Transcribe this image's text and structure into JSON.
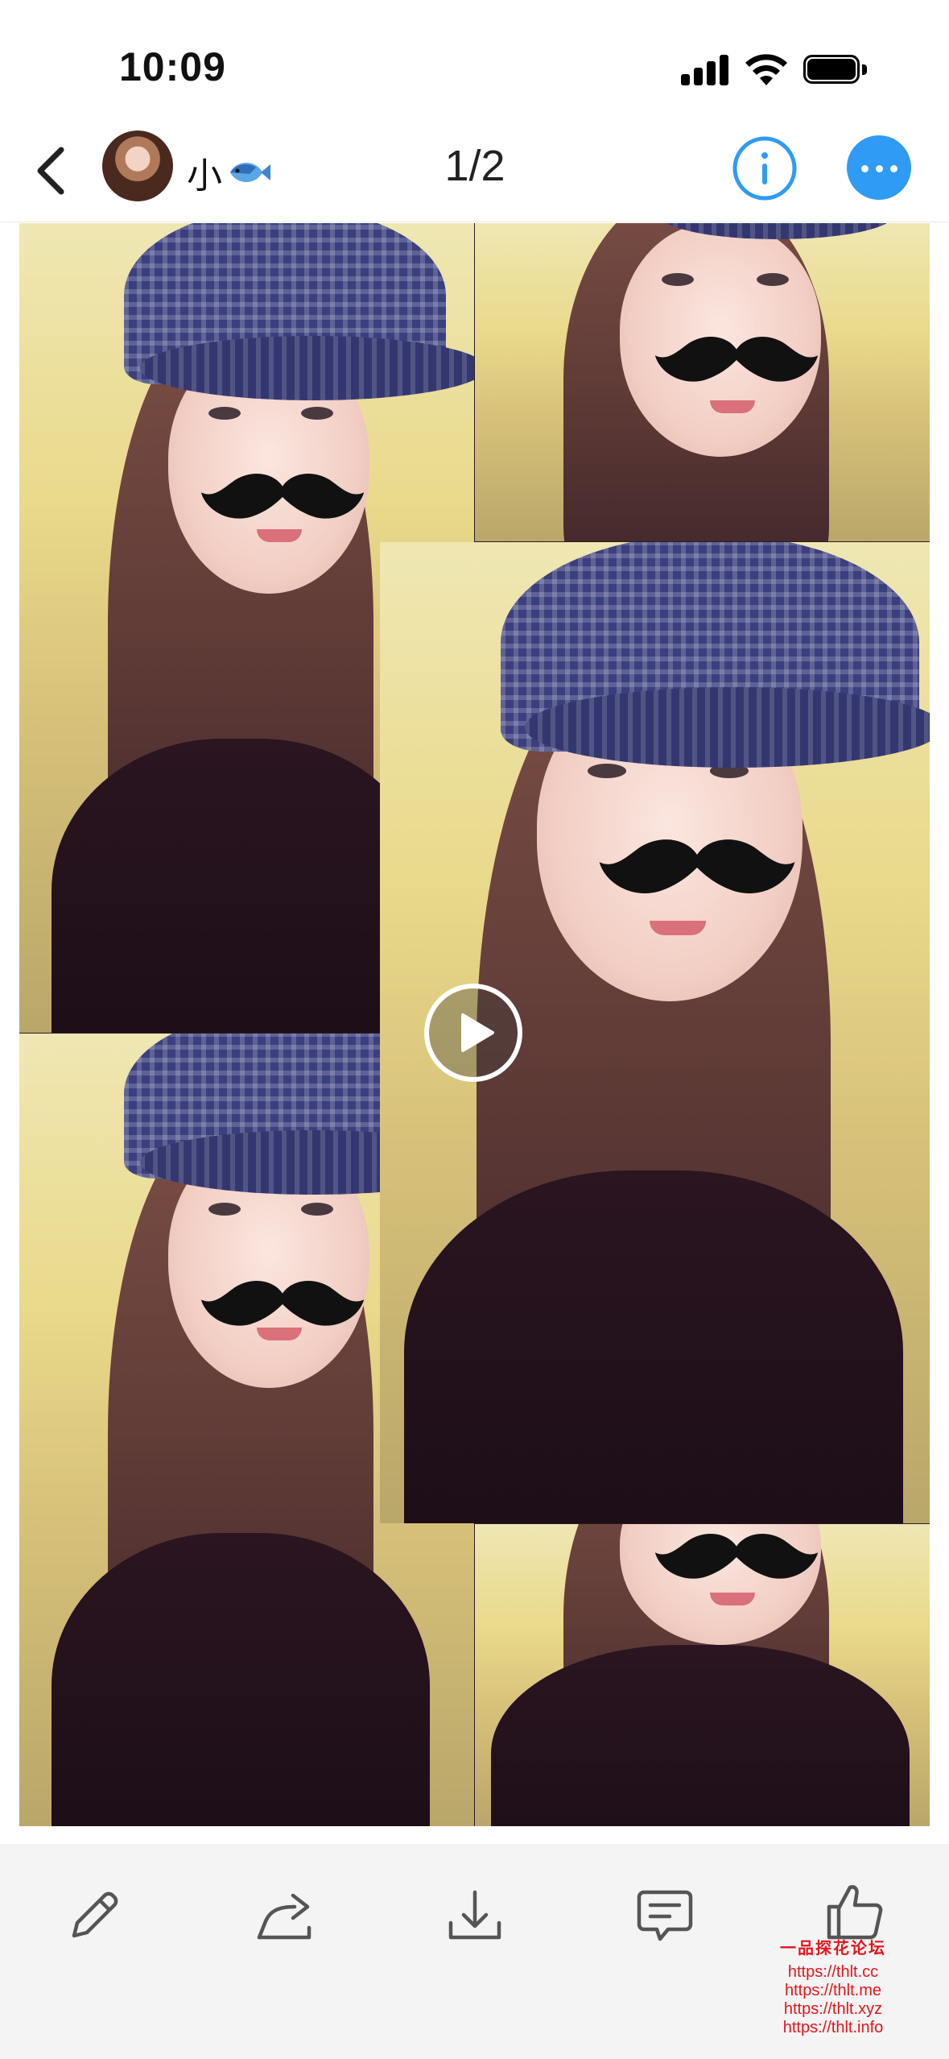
{
  "status_bar": {
    "time": "10:09"
  },
  "nav": {
    "username": "小",
    "counter": "1/2"
  },
  "toolbar": {
    "icons": [
      "pencil-icon",
      "share-icon",
      "download-icon",
      "comment-icon",
      "thumbs-up-icon"
    ]
  },
  "watermark": {
    "title": "一品探花论坛",
    "urls": [
      "https://thlt.cc",
      "https://thlt.me",
      "https://thlt.xyz",
      "https://thlt.info"
    ]
  },
  "colors": {
    "accent": "#2f9bf5",
    "watermark": "#e2151b",
    "toolbar_bg": "#f4f4f4"
  }
}
